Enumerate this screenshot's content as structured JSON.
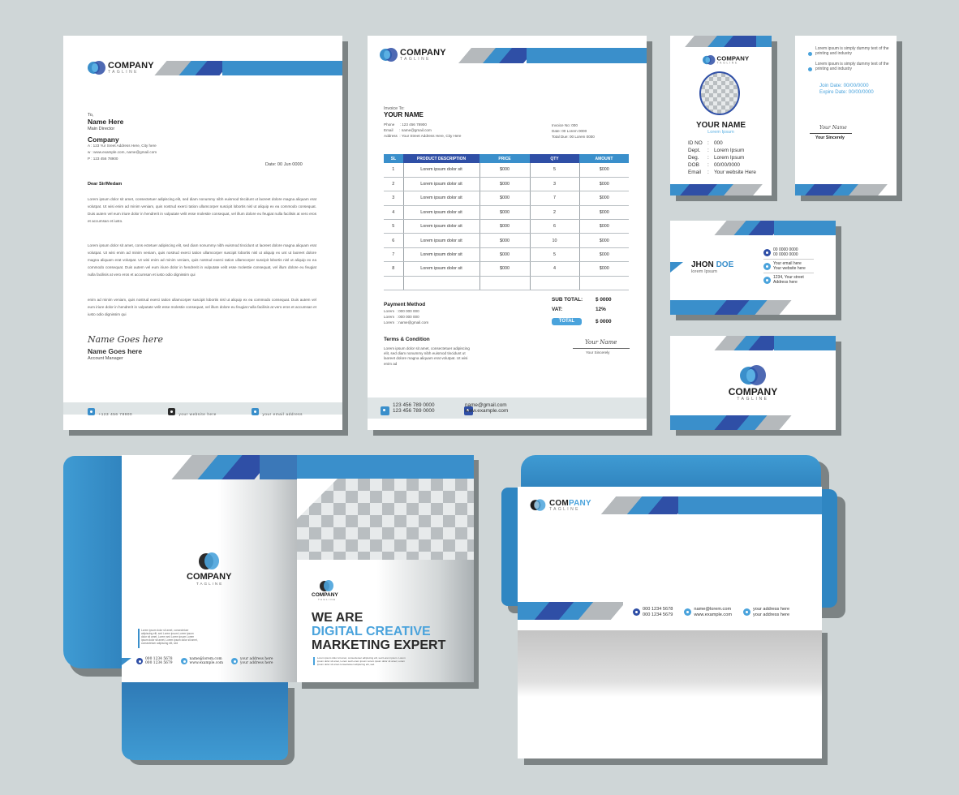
{
  "brand": {
    "name": "COMPANY",
    "tagline": "TAGLINE",
    "colors": {
      "light_blue": "#3a8fcb",
      "dark_blue": "#2f4fa6",
      "gray": "#b5b9bc",
      "background": "#cfd6d7"
    }
  },
  "letterhead": {
    "to_label": "To,",
    "recipient_name": "Name Here",
    "recipient_title": "Main Director",
    "company": "Company",
    "address_line": "A : 123 Yur Sreet Address Here, City here",
    "web_line": "w : www.example.com, name@gmail.com",
    "phone_line": "P : 123 456 78900",
    "date": "Date: 00 Jun 0000",
    "salutation": "Dear Sir/Medam",
    "paragraphs": [
      "Lorem ipsum dolor sit amet, consectetuer adipiscing elit, sed diam nonummy nibh euismod tincidunt ut laoreet dolore magna aliquam erat volutpat. Ut wisi enim ad minim veniam, quis nostrud exerci tation ullamcorper suscipit lobortis nisl ut aliquip ex ea commodo consequat. Duis autem vel eum iriure dolor in hendrerit in vulputate velit esse molestie consequat, vel illum dolore eu feugiat nulla facilisis at vero eros et accumsan et iusto.",
      "Lorem ipsum dolor sit amet, cons ectetuer adipiscing elit, sed diam nonummy nibh euismod tincidunt ut laoreet dolore magna aliquam erat volutpat. Ut wisi enim ad minim veniam, quis nostrud exerci tation ullamcorper suscipit lobortis nisl ut aliquip ex unt ut laoreet dolore magna aliquam erat volutpat. Ut wisi enim ad minim veniam, quis nostrud exerci tation ullamcorper suscipit lobortis nisl ut aliquip ex ea commodo consequat. Duis autem vel eum iriure dolor in hendrerit in vulputate velit esse molestie consequat, vel illum dolore eu feugiat nulla facilisis at vero eros et accumsan et iusto odio dignissim qui",
      "enim ad minim veniam, quis nostrud exerci tation ullamcorper suscipit lobortis nisl ut aliquip ex ea commodo consequat. Duis autem vel eum iriure dolor in hendrerit in vulputate velit esse molestie consequat, vel illum dolore eu feugiat nulla facilisis at vero eros et accumsan et iusto odio dignissim qui"
    ],
    "signature_script": "Name Goes here",
    "signer_name": "Name Goes here",
    "signer_title": "Account Manager",
    "footer": {
      "phone": "+123 456 78900",
      "website": "your website here",
      "email": "your email address"
    }
  },
  "invoice": {
    "invoice_to_label": "Invoice To:",
    "client_name": "YOUR NAME",
    "phone": "Phone     : 123 456 78900",
    "email": "Email      : name@gmail.com",
    "address": "Address  : Your Street Address Here, City Here",
    "invoice_no": "Invoice No: 000",
    "date": "Date: 00 Lorem 0000",
    "total_due": "Total Due: 00 Lorem 0000",
    "columns": [
      "SL",
      "PRODUCT DESCRIPTION",
      "PRICE",
      "QTY",
      "AMOUNT"
    ],
    "rows": [
      [
        "1",
        "Lorem ipsum dolor sit",
        "$000",
        "5",
        "$000"
      ],
      [
        "2",
        "Lorem ipsum dolor sit",
        "$000",
        "3",
        "$000"
      ],
      [
        "3",
        "Lorem ipsum dolor sit",
        "$000",
        "7",
        "$000"
      ],
      [
        "4",
        "Lorem ipsum dolor sit",
        "$000",
        "2",
        "$000"
      ],
      [
        "5",
        "Lorem ipsum dolor sit",
        "$000",
        "6",
        "$000"
      ],
      [
        "6",
        "Lorem ipsum dolor sit",
        "$000",
        "10",
        "$000"
      ],
      [
        "7",
        "Lorem ipsum dolor sit",
        "$000",
        "5",
        "$000"
      ],
      [
        "8",
        "Lorem ipsum dolor sit",
        "$000",
        "4",
        "$000"
      ],
      [
        "",
        "",
        "",
        "",
        ""
      ]
    ],
    "payment_method_title": "Payment Method",
    "payment_lines": [
      "Lorem  : 000 000 000",
      "Lorem  : 000 000 000",
      "Lorem  : name@gmail.com"
    ],
    "subtotal_label": "SUB TOTAL:",
    "subtotal_value": "$ 0000",
    "vat_label": "VAT:",
    "vat_value": "12%",
    "total_label": "TOTAL",
    "total_value": "$ 0000",
    "terms_title": "Terms & Condition",
    "terms_text": "Lorem ipsum dolor sit amet, consectetuer adipiscing elit, sed diam nonummy nibh euismod tincidunt ut laoreet dolore magna aliquam erat volutpat. Ut wisi enim ad",
    "signature_script": "Your Name",
    "sign_label": "Your Sincerely",
    "footer": {
      "phone1": "123 456 789 0000",
      "phone2": "123 456 789 0000",
      "email": "name@gmail.com",
      "web": "www.example.com"
    }
  },
  "id_card_front": {
    "name": "YOUR NAME",
    "subtitle": "Lorem Ipsum",
    "fields": [
      {
        "label": "ID NO",
        "value": "000"
      },
      {
        "label": "Dept.",
        "value": "Lorem Ipsum"
      },
      {
        "label": "Deg.",
        "value": "Lorem Ipsum"
      },
      {
        "label": "DOB",
        "value": "00/00/0000"
      },
      {
        "label": "Email",
        "value": "Your website Here"
      }
    ]
  },
  "id_card_back": {
    "bullets": [
      "Lorem ipsum  is simply dummy text of the printing and industry",
      "Lorem ipsum  is simply dummy text of the printing and industry"
    ],
    "join_date": "Join Date: 00/00/0000",
    "expire_date": "Expire Date: 00/00/0000",
    "signature_script": "Your Name",
    "sign_label": "Your Sincerely"
  },
  "business_card_front": {
    "first_name": "JHON",
    "last_name": "DOE",
    "subtitle": "lorem Ipsum",
    "contacts": [
      {
        "icon": "phone-icon",
        "line1": "00 0000 0000",
        "line2": "00 0000 0000"
      },
      {
        "icon": "email-icon",
        "line1": "Your email here",
        "line2": "Your website here"
      },
      {
        "icon": "location-icon",
        "line1": "1234, Your street",
        "line2": "Address here"
      }
    ]
  },
  "folder": {
    "blurb": "Lorem ipsum dolor sit amet, consectetuer adipiscing elit, sed Lorem ipsum Lorem ipsum dolor sit amet, Lorem sed Lorem ipsum Lorem ipsum dolor sit amet, Lorem ipsum dolor sit amet, consectetuer adipiscing elit, sed",
    "contacts": [
      {
        "icon": "phone-icon",
        "line1": "000 1234 5678",
        "line2": "000 1234 5679"
      },
      {
        "icon": "email-icon",
        "line1": "name@lorem.com",
        "line2": "www.example.com"
      },
      {
        "icon": "location-icon",
        "line1": "your address here",
        "line2": "your address here"
      }
    ],
    "headline_1": "WE ARE",
    "headline_2": "DIGITAL CREATIVE",
    "headline_3": "MARKETING EXPERT",
    "cover_blurb": "Lorem ipsum dolor sit amet, consectetuer adipiscing elit, sed Lorem ipsum. Lorem ipsum dolor sit amet, Lorem sed Lorem ipsum Lorem ipsum dolor sit amet, Lorem ipsum dolor sit amet consectetuer adipiscing elit, sed."
  },
  "envelope": {
    "brand_part1": "COM",
    "brand_part2": "PANY",
    "contacts": [
      {
        "icon": "phone-icon",
        "line1": "000 1234 5678",
        "line2": "000 1234 5679"
      },
      {
        "icon": "email-icon",
        "line1": "name@lorem.com",
        "line2": "www.example.com"
      },
      {
        "icon": "location-icon",
        "line1": "your address here",
        "line2": "your address here"
      }
    ]
  }
}
